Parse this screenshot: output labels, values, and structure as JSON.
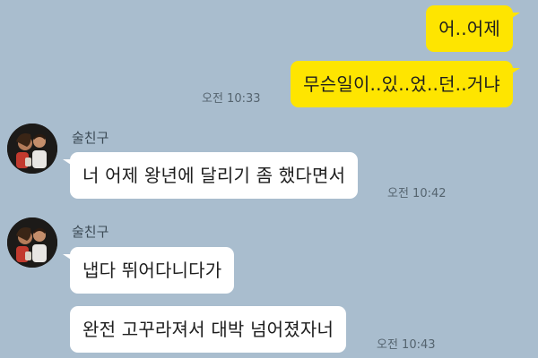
{
  "colors": {
    "background": "#a9bdce",
    "my_bubble": "#fee500",
    "friend_bubble": "#ffffff"
  },
  "messages": [
    {
      "side": "mine",
      "text": "어..어제",
      "time": ""
    },
    {
      "side": "mine",
      "text": "무슨일이..있..었..던..거냐",
      "time": "오전 10:33"
    },
    {
      "side": "theirs",
      "sender": "술친구",
      "avatar": "friend-photo-icon",
      "text": "너 어제 왕년에 달리기 좀 했다면서",
      "time": "오전 10:42"
    },
    {
      "side": "theirs",
      "sender": "술친구",
      "avatar": "friend-photo-icon",
      "text": "냅다 뛰어다니다가",
      "time": ""
    },
    {
      "side": "theirs",
      "text": "완전 고꾸라져서 대박 넘어졌자너",
      "time": "오전 10:43"
    }
  ]
}
